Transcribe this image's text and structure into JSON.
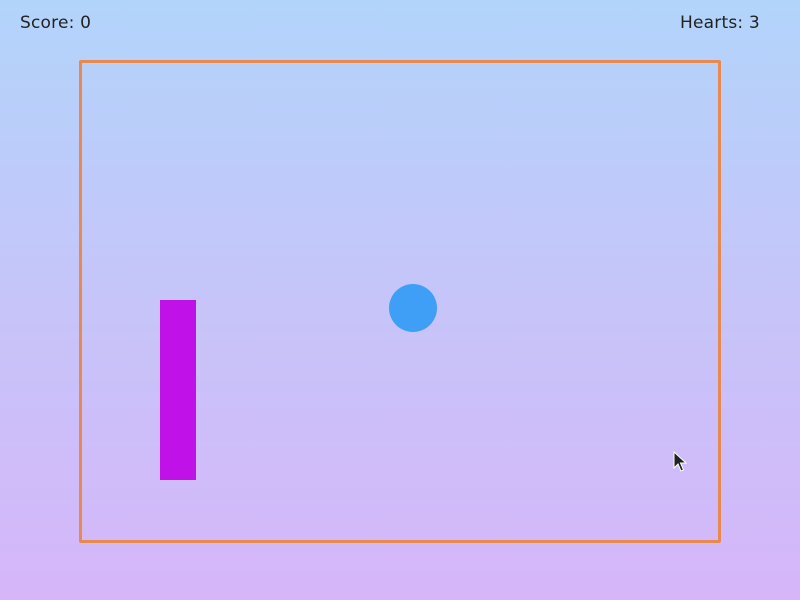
{
  "hud": {
    "score_label": "Score: 0",
    "hearts_label": "Hearts: 3"
  },
  "colors": {
    "arena_border": "#e8894f",
    "paddle": "#c012e8",
    "ball": "#3f9ff7",
    "background_top": "#b2d4fb",
    "background_bottom": "#d6b6f9"
  },
  "icons": {
    "cursor": "mouse-pointer-icon"
  }
}
